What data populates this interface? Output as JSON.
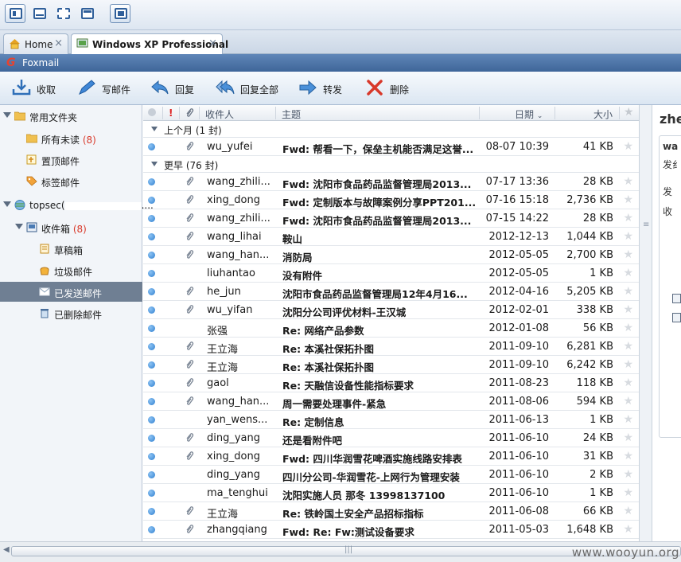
{
  "tabs": [
    {
      "label": "Home",
      "close": "×"
    },
    {
      "label": "Windows XP Professional",
      "close": "×"
    }
  ],
  "app": {
    "title": "Foxmail"
  },
  "toolbar": {
    "receive": "收取",
    "compose": "写邮件",
    "reply": "回复",
    "reply_all": "回复全部",
    "forward": "转发",
    "delete": "删除"
  },
  "sidebar": {
    "common_folder": "常用文件夹",
    "unread": {
      "label": "所有未读",
      "count": "(8)"
    },
    "pinned": "置顶邮件",
    "tagged": "标签邮件",
    "account": "topsec(",
    "account_suffix": "....",
    "inbox": {
      "label": "收件箱",
      "count": "(8)"
    },
    "drafts": "草稿箱",
    "junk": "垃圾邮件",
    "sent": "已发送邮件",
    "deleted": "已删除邮件"
  },
  "list_header": {
    "priority": "!",
    "sender": "收件人",
    "subject": "主题",
    "date": "日期",
    "size": "大小"
  },
  "groups": [
    {
      "label": "上个月 (1 封)"
    },
    {
      "label": "更早 (76 封)"
    }
  ],
  "emails": [
    {
      "sender": "wu_yufei",
      "subject": "Fwd: 帮看一下，保垒主机能否满足这誉...",
      "date": "08-07 10:39",
      "size": "41 KB",
      "attach": true
    },
    {
      "sender": "wang_zhili...",
      "subject": "Fwd: 沈阳市食品药品监督管理局2013...",
      "date": "07-17 13:36",
      "size": "28 KB",
      "attach": true
    },
    {
      "sender": "xing_dong",
      "subject": "Fwd: 定制版本与故障案例分享PPT201...",
      "date": "07-16 15:18",
      "size": "2,736 KB",
      "attach": true
    },
    {
      "sender": "wang_zhili...",
      "subject": "Fwd: 沈阳市食品药品监督管理局2013...",
      "date": "07-15 14:22",
      "size": "28 KB",
      "attach": true
    },
    {
      "sender": "wang_lihai",
      "subject": "鞍山",
      "date": "2012-12-13",
      "size": "1,044 KB",
      "attach": true
    },
    {
      "sender": "wang_han...",
      "subject": "消防局",
      "date": "2012-05-05",
      "size": "2,700 KB",
      "attach": true
    },
    {
      "sender": "liuhantao",
      "subject": "没有附件",
      "date": "2012-05-05",
      "size": "1 KB",
      "attach": false
    },
    {
      "sender": "he_jun",
      "subject": "沈阳市食品药品监督管理局12年4月16...",
      "date": "2012-04-16",
      "size": "5,205 KB",
      "attach": true
    },
    {
      "sender": "wu_yifan",
      "subject": "沈阳分公司评优材料-王汉城",
      "date": "2012-02-01",
      "size": "338 KB",
      "attach": true
    },
    {
      "sender": "张强",
      "subject": "Re: 网络产品参数",
      "date": "2012-01-08",
      "size": "56 KB",
      "attach": false
    },
    {
      "sender": "王立海",
      "subject": "Re: 本溪社保拓扑图",
      "date": "2011-09-10",
      "size": "6,281 KB",
      "attach": true
    },
    {
      "sender": "王立海",
      "subject": "Re: 本溪社保拓扑图",
      "date": "2011-09-10",
      "size": "6,242 KB",
      "attach": true
    },
    {
      "sender": "gaol",
      "subject": "Re: 天融信设备性能指标要求",
      "date": "2011-08-23",
      "size": "118 KB",
      "attach": true
    },
    {
      "sender": "wang_han...",
      "subject": "周一需要处理事件-紧急",
      "date": "2011-08-06",
      "size": "594 KB",
      "attach": true
    },
    {
      "sender": "yan_wens...",
      "subject": "Re: 定制信息",
      "date": "2011-06-13",
      "size": "1 KB",
      "attach": false
    },
    {
      "sender": "ding_yang",
      "subject": "还是看附件吧",
      "date": "2011-06-10",
      "size": "24 KB",
      "attach": true
    },
    {
      "sender": "xing_dong",
      "subject": "Fwd: 四川华润雪花啤酒实施线路安排表",
      "date": "2011-06-10",
      "size": "31 KB",
      "attach": true
    },
    {
      "sender": "ding_yang",
      "subject": "四川分公司-华润雪花-上网行为管理安装",
      "date": "2011-06-10",
      "size": "2 KB",
      "attach": false
    },
    {
      "sender": "ma_tenghui",
      "subject": "沈阳实施人员 那冬 13998137100",
      "date": "2011-06-10",
      "size": "1 KB",
      "attach": false
    },
    {
      "sender": "王立海",
      "subject": "Re: 铁岭国土安全产品招标指标",
      "date": "2011-06-08",
      "size": "66 KB",
      "attach": true
    },
    {
      "sender": "zhangqiang",
      "subject": "Fwd: Re: Fw:测试设备要求",
      "date": "2011-05-03",
      "size": "1,648 KB",
      "attach": true
    }
  ],
  "reader": {
    "name": "zhe",
    "line1": "wa",
    "line2": "发纟",
    "line3": "发",
    "line4": "收"
  },
  "watermark": "www.wooyun.org",
  "colors": {
    "accent": "#3f6699",
    "unread_count": "#d93a2b",
    "selected": "#6f7f93"
  }
}
